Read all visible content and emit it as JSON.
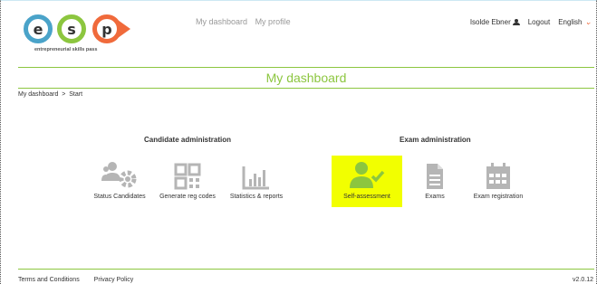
{
  "header": {
    "logo_letters": [
      "e",
      "s",
      "p"
    ],
    "logo_tagline": "entrepreneurial skills pass",
    "nav": [
      "My dashboard",
      "My profile"
    ],
    "user_name": "Isolde Ebner",
    "logout": "Logout",
    "language": "English"
  },
  "title": "My dashboard",
  "breadcrumb": "My dashboard  >  Start",
  "candidate_admin": {
    "title": "Candidate administration",
    "items": [
      {
        "label": "Status Candidates",
        "icon": "users-gear-icon"
      },
      {
        "label": "Generate reg codes",
        "icon": "qr-code-icon"
      },
      {
        "label": "Statistics & reports",
        "icon": "bar-chart-icon"
      }
    ]
  },
  "exam_admin": {
    "title": "Exam administration",
    "items": [
      {
        "label": "Self-assessment",
        "icon": "user-check-icon",
        "highlighted": true
      },
      {
        "label": "Exams",
        "icon": "document-icon"
      },
      {
        "label": "Exam registration",
        "icon": "calendar-icon"
      }
    ]
  },
  "footer": {
    "links": [
      "Terms and Conditions",
      "Privacy Policy"
    ],
    "version": "v2.0.12"
  },
  "colors": {
    "accent_green": "#8cc63f",
    "logo_blue": "#4aa3c9",
    "logo_orange": "#f06a3b",
    "highlight_yellow": "#f2ff00",
    "icon_grey": "#b5b5b5"
  }
}
